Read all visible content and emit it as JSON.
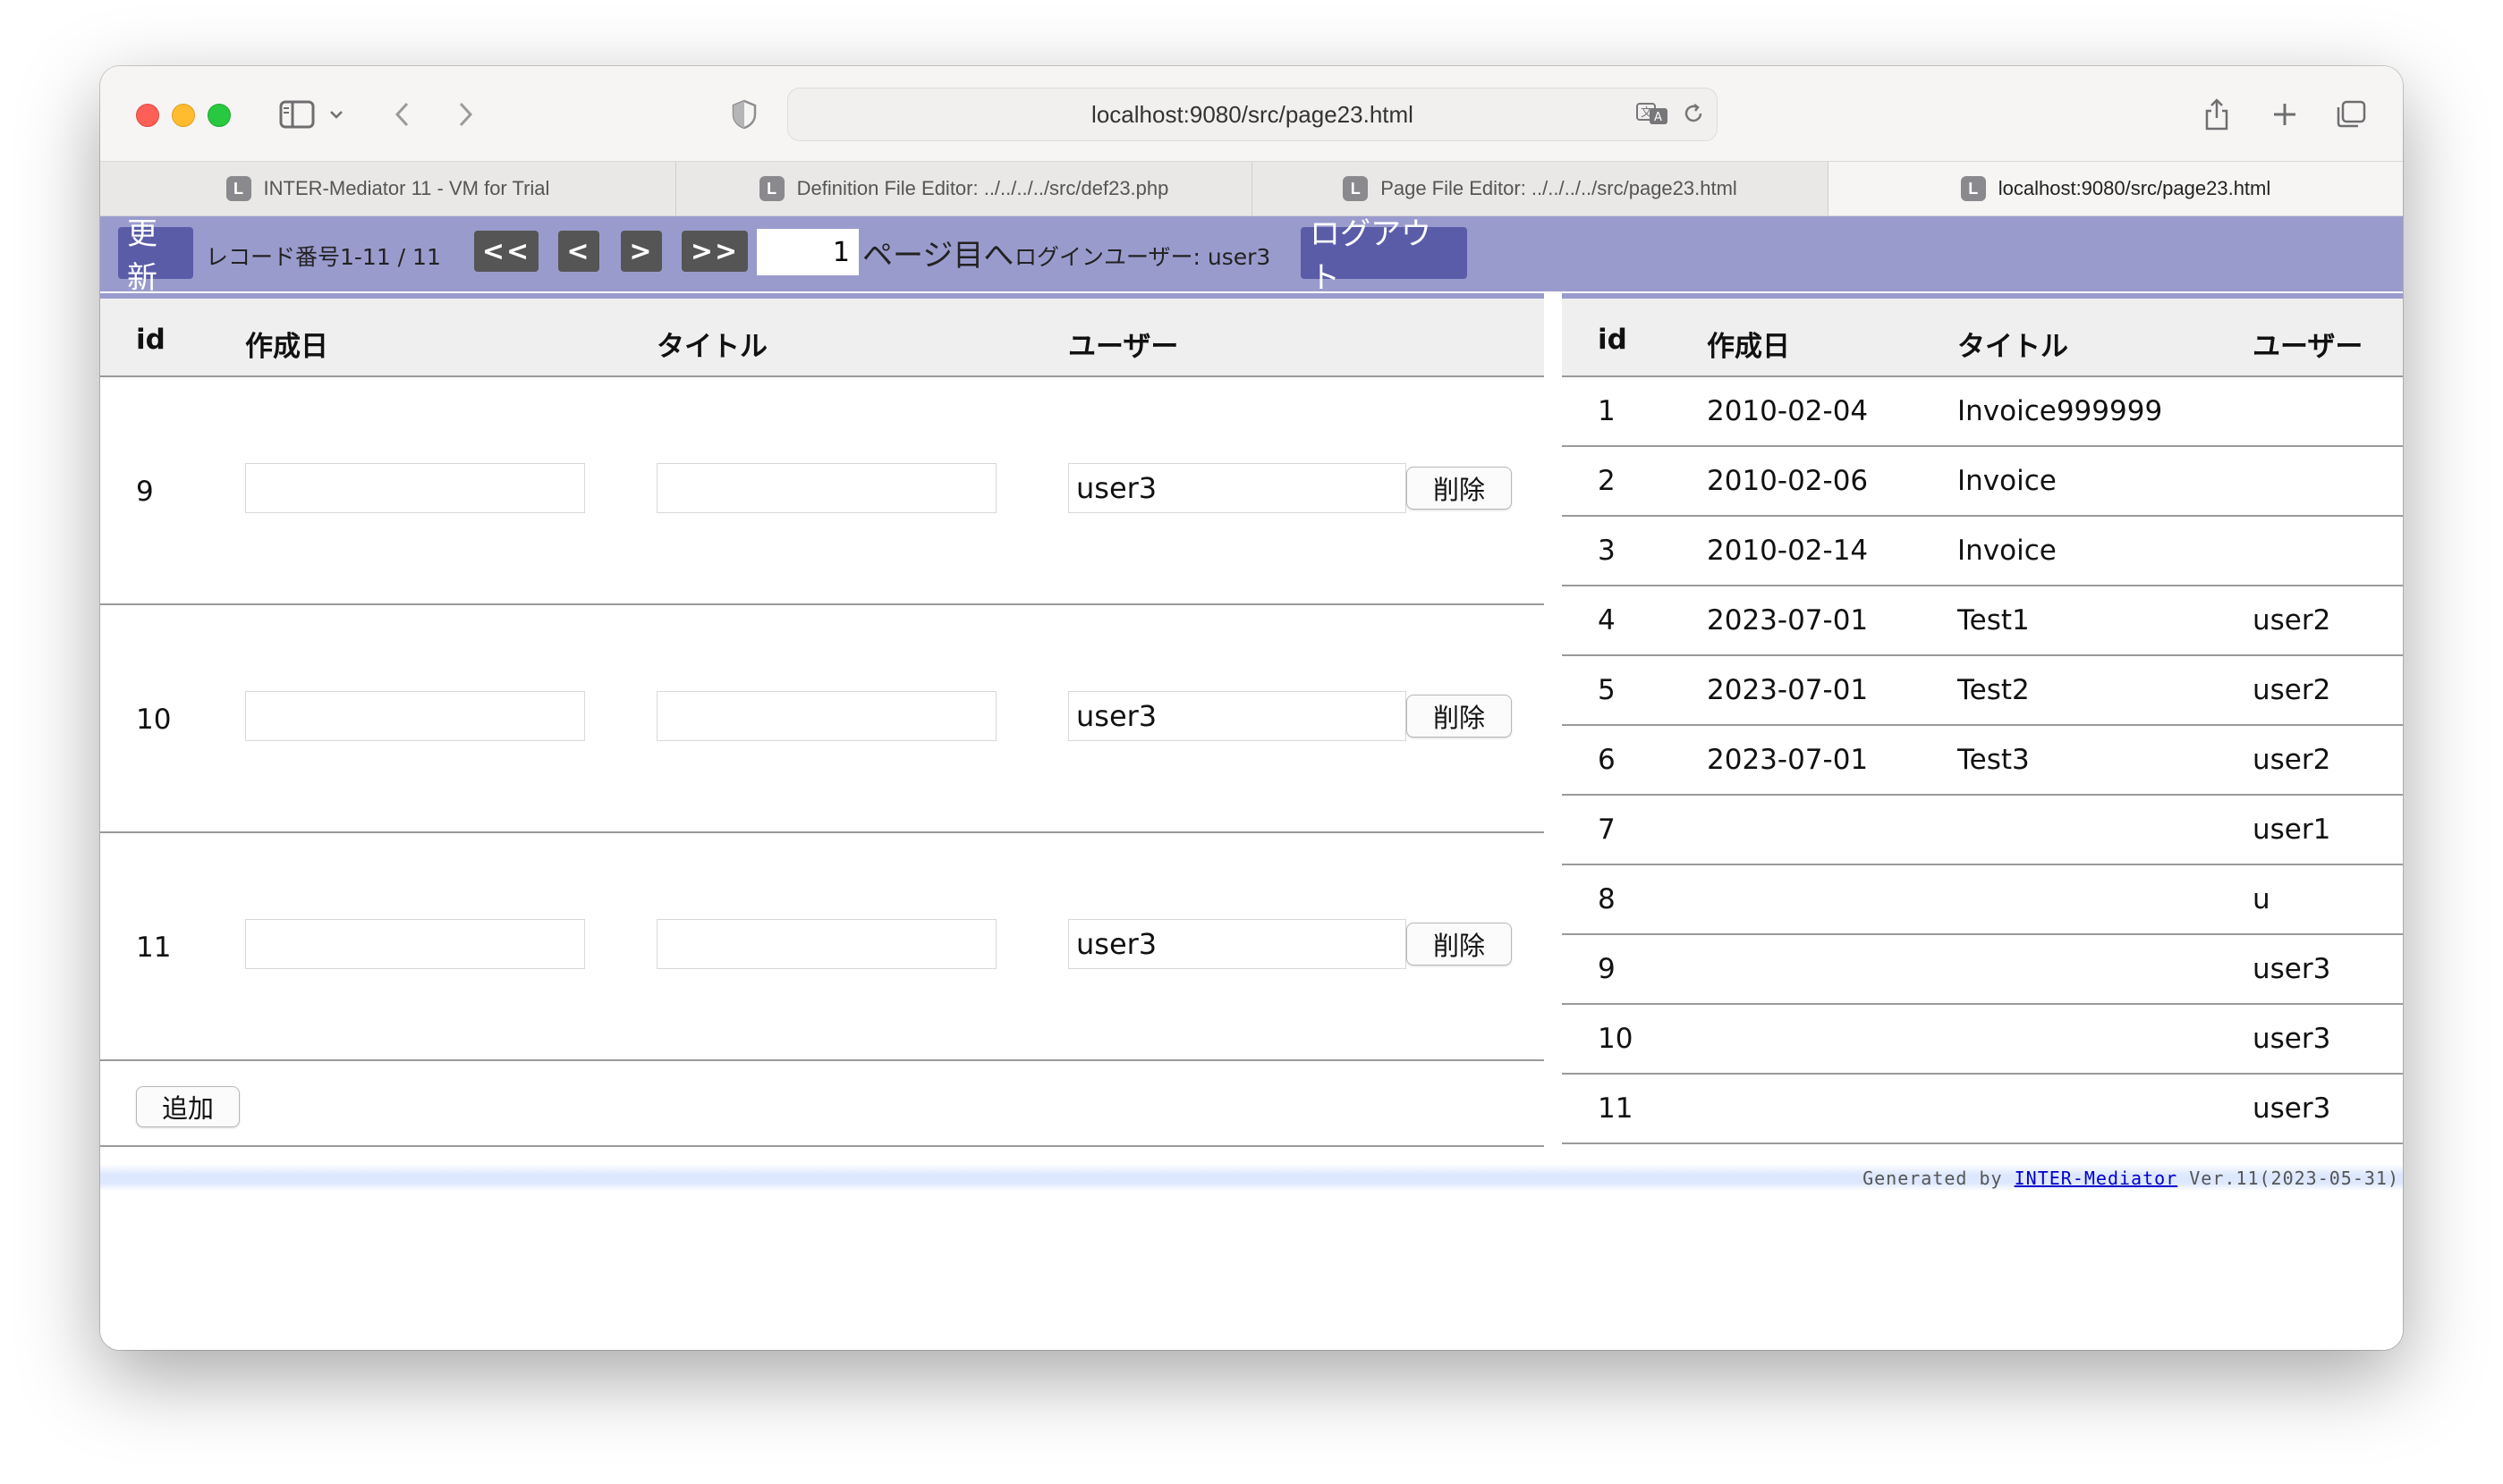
{
  "browser": {
    "url": "localhost:9080/src/page23.html",
    "tabs": [
      {
        "label": "INTER-Mediator 11 - VM for Trial",
        "favicon": "L"
      },
      {
        "label": "Definition File Editor: ../../../../src/def23.php",
        "favicon": "L"
      },
      {
        "label": "Page File Editor: ../../../../src/page23.html",
        "favicon": "L"
      },
      {
        "label": "localhost:9080/src/page23.html",
        "favicon": "L"
      }
    ]
  },
  "navigation": {
    "refresh_label": "更新",
    "record_info": "レコード番号1-11 / 11",
    "first_label": "<<",
    "prev_label": "<",
    "next_label": ">",
    "last_label": ">>",
    "page_value": "1",
    "page_suffix": "ページ目へ",
    "login_user": "ログインユーザー: user3",
    "logout_label": "ログアウト"
  },
  "left_table": {
    "headers": [
      "id",
      "作成日",
      "タイトル",
      "ユーザー"
    ],
    "rows": [
      {
        "id": "9",
        "created": "",
        "title": "",
        "user": "user3"
      },
      {
        "id": "10",
        "created": "",
        "title": "",
        "user": "user3"
      },
      {
        "id": "11",
        "created": "",
        "title": "",
        "user": "user3"
      }
    ],
    "delete_label": "削除",
    "add_label": "追加"
  },
  "right_table": {
    "headers": [
      "id",
      "作成日",
      "タイトル",
      "ユーザー"
    ],
    "rows": [
      {
        "id": "1",
        "created": "2010-02-04",
        "title": "Invoice999999",
        "user": ""
      },
      {
        "id": "2",
        "created": "2010-02-06",
        "title": "Invoice",
        "user": ""
      },
      {
        "id": "3",
        "created": "2010-02-14",
        "title": "Invoice",
        "user": ""
      },
      {
        "id": "4",
        "created": "2023-07-01",
        "title": "Test1",
        "user": "user2"
      },
      {
        "id": "5",
        "created": "2023-07-01",
        "title": "Test2",
        "user": "user2"
      },
      {
        "id": "6",
        "created": "2023-07-01",
        "title": "Test3",
        "user": "user2"
      },
      {
        "id": "7",
        "created": "",
        "title": "",
        "user": "user1"
      },
      {
        "id": "8",
        "created": "",
        "title": "",
        "user": "u"
      },
      {
        "id": "9",
        "created": "",
        "title": "",
        "user": "user3"
      },
      {
        "id": "10",
        "created": "",
        "title": "",
        "user": "user3"
      },
      {
        "id": "11",
        "created": "",
        "title": "",
        "user": "user3"
      }
    ]
  },
  "footer": {
    "prefix": "Generated by ",
    "link": "INTER-Mediator",
    "suffix": " Ver.11(2023-05-31)"
  }
}
